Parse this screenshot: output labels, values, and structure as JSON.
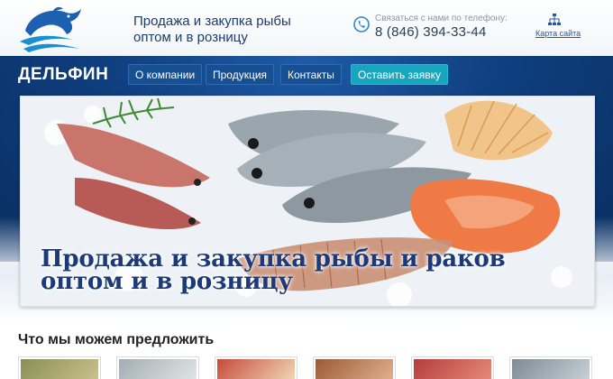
{
  "header": {
    "tagline_line1": "Продажа и закупка рыбы",
    "tagline_line2": "оптом и в розницу",
    "contact_label": "Связаться с нами по телефону:",
    "phone": "8 (846) 394-33-44",
    "sitemap_label": "Карта сайта"
  },
  "brand": {
    "name": "ДЕЛЬФИН"
  },
  "nav": {
    "items": [
      "О компании",
      "Продукция",
      "Контакты"
    ],
    "cta": "Оставить заявку"
  },
  "hero": {
    "line1": "Продажа и закупка рыбы и раков",
    "line2": "оптом и в розницу"
  },
  "offers": {
    "title": "Что мы можем предложить"
  },
  "colors": {
    "brand_blue": "#0f3f7f",
    "accent_teal": "#16a6be",
    "hero_text": "#1d3a78"
  }
}
